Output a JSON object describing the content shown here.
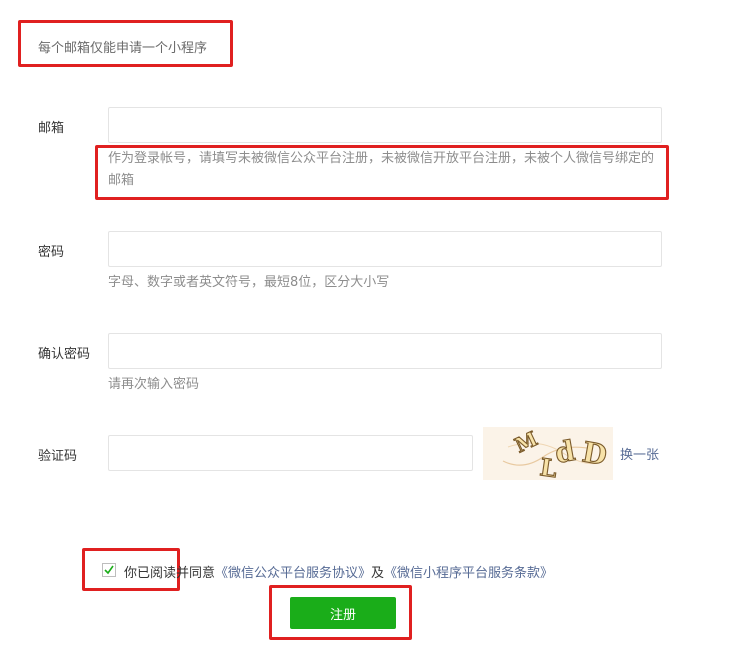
{
  "notice": "每个邮箱仅能申请一个小程序",
  "form": {
    "email": {
      "label": "邮箱",
      "value": "",
      "hint": "作为登录帐号，请填写未被微信公众平台注册，未被微信开放平台注册，未被个人微信号绑定的邮箱"
    },
    "password": {
      "label": "密码",
      "value": "",
      "hint": "字母、数字或者英文符号，最短8位，区分大小写"
    },
    "confirm_password": {
      "label": "确认密码",
      "value": "",
      "hint": "请再次输入密码"
    },
    "captcha": {
      "label": "验证码",
      "value": "",
      "image_text": "MLdD",
      "refresh_label": "换一张"
    }
  },
  "agreement": {
    "checked": true,
    "prefix": "你已阅读并同意",
    "link1": "《微信公众平台服务协议》",
    "joiner": "及",
    "link2": "《微信小程序平台服务条款》"
  },
  "submit_label": "注册",
  "colors": {
    "primary_green": "#1aad19",
    "link_blue": "#576b95",
    "highlight_red": "#e02020"
  }
}
